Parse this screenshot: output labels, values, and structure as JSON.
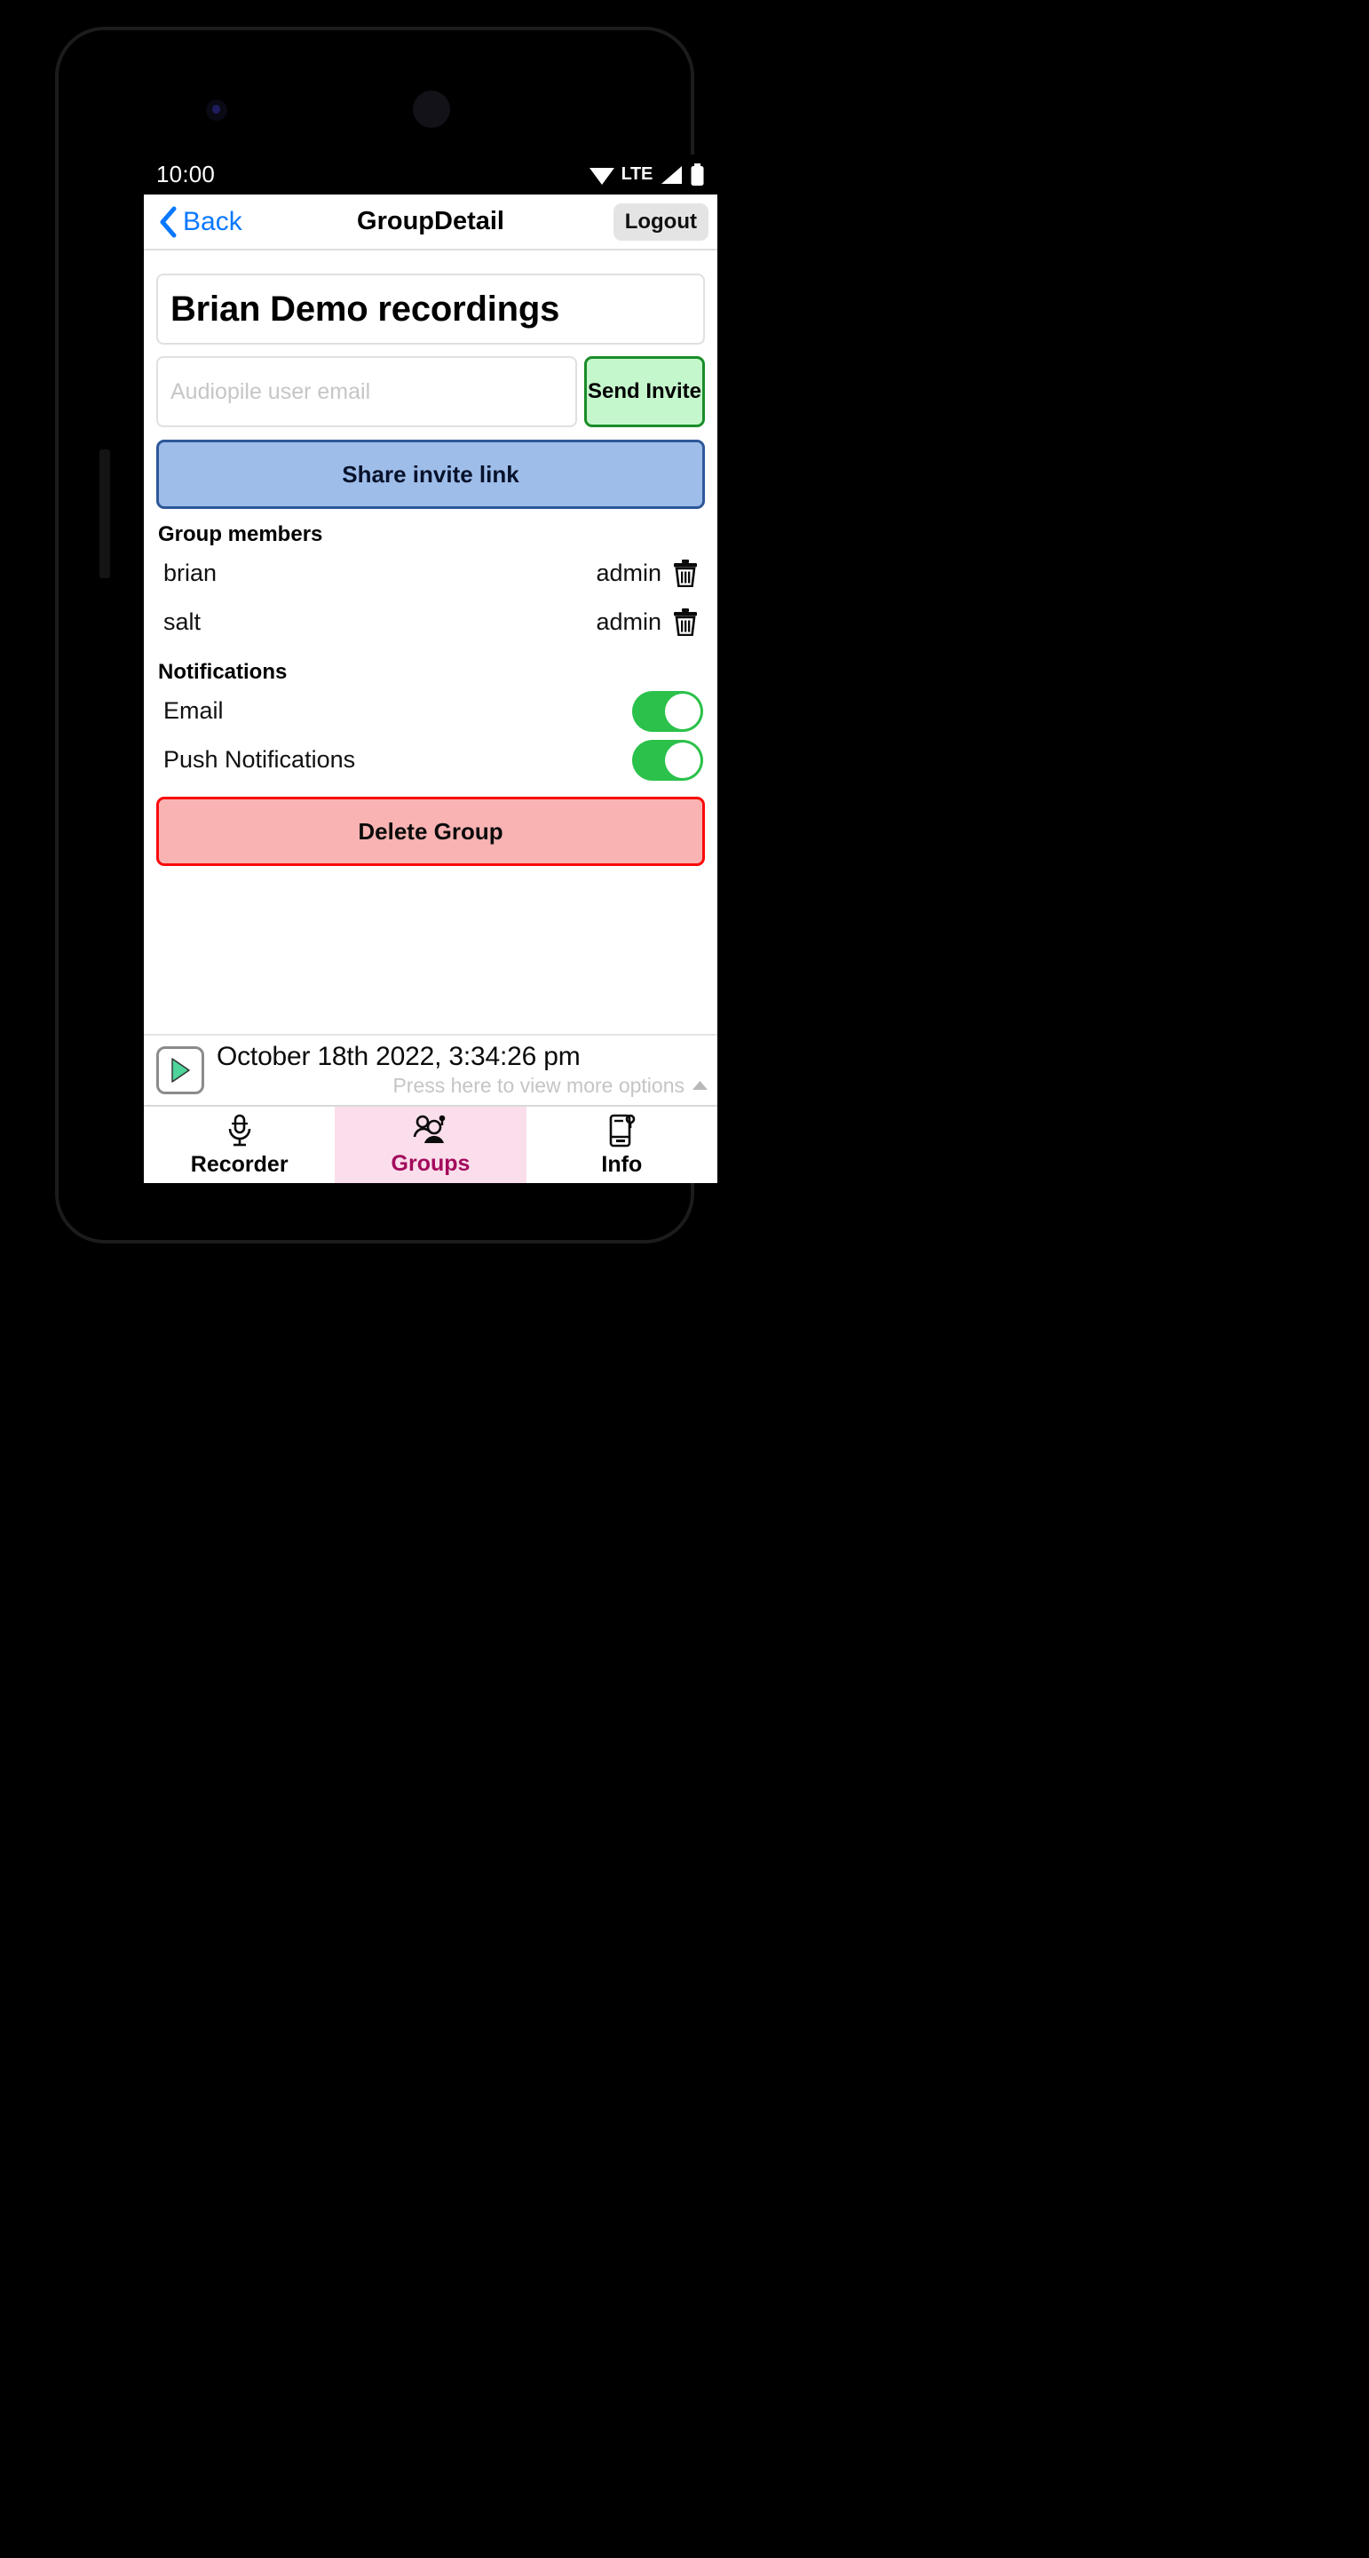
{
  "status_bar": {
    "time": "10:00",
    "network_label": "LTE",
    "wifi_icon": "wifi-icon",
    "signal_icon": "signal-bars-icon",
    "battery_icon": "battery-icon"
  },
  "nav": {
    "back_label": "Back",
    "back_icon": "chevron-left-icon",
    "title": "GroupDetail",
    "logout_label": "Logout"
  },
  "group": {
    "name": "Brian Demo recordings",
    "invite_email_value": "",
    "invite_email_placeholder": "Audiopile user email",
    "send_invite_label": "Send Invite",
    "share_invite_label": "Share invite link"
  },
  "members_section": {
    "heading": "Group members",
    "rows": [
      {
        "name": "brian",
        "role": "admin",
        "delete_icon": "trash-icon"
      },
      {
        "name": "salt",
        "role": "admin",
        "delete_icon": "trash-icon"
      }
    ]
  },
  "notifications_section": {
    "heading": "Notifications",
    "rows": [
      {
        "label": "Email",
        "enabled": true
      },
      {
        "label": "Push Notifications",
        "enabled": true
      }
    ]
  },
  "danger": {
    "delete_group_label": "Delete Group"
  },
  "player": {
    "play_icon": "play-icon",
    "recording_date": "October 18th 2022, 3:34:26 pm",
    "more_options_label": "Press here to view more options",
    "more_options_icon": "caret-up-icon"
  },
  "tabs": [
    {
      "label": "Recorder",
      "icon": "microphone-icon",
      "active": false
    },
    {
      "label": "Groups",
      "icon": "people-group-icon",
      "active": true
    },
    {
      "label": "Info",
      "icon": "phone-info-icon",
      "active": false
    }
  ],
  "colors": {
    "accent_blue": "#0a78ff",
    "invite_green_bg": "#c5f7cd",
    "invite_green_border": "#1a8c28",
    "share_blue_bg": "#9ebde9",
    "share_blue_border": "#2d5899",
    "delete_red_bg": "#f9b3b3",
    "delete_red_border": "#fa0a0a",
    "toggle_on": "#2bc14a",
    "active_tab_bg": "#fbdeeb",
    "active_tab_text": "#a30a5c"
  }
}
